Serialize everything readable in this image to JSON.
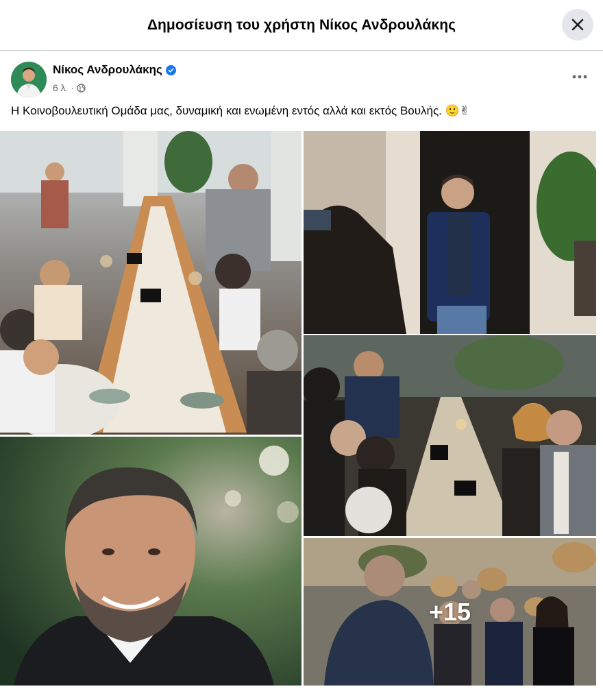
{
  "header": {
    "title": "Δημοσίευση του χρήστη Νίκος Ανδρουλάκης"
  },
  "post": {
    "author": "Νίκος Ανδρουλάκης",
    "time": "6 λ.",
    "separator": "·",
    "text": "Η Κοινοβουλευτική Ομάδα μας, δυναμική και ενωμένη εντός αλλά και εκτός Βουλής.",
    "emojis": "🙂✌"
  },
  "gallery": {
    "more_count": "+15"
  },
  "colors": {
    "verified_blue": "#1877f2",
    "text_primary": "#050505",
    "text_secondary": "#65676b",
    "close_bg": "#e4e6eb"
  },
  "icons": [
    "close-icon",
    "verified-badge-icon",
    "globe-icon",
    "more-options-icon"
  ]
}
